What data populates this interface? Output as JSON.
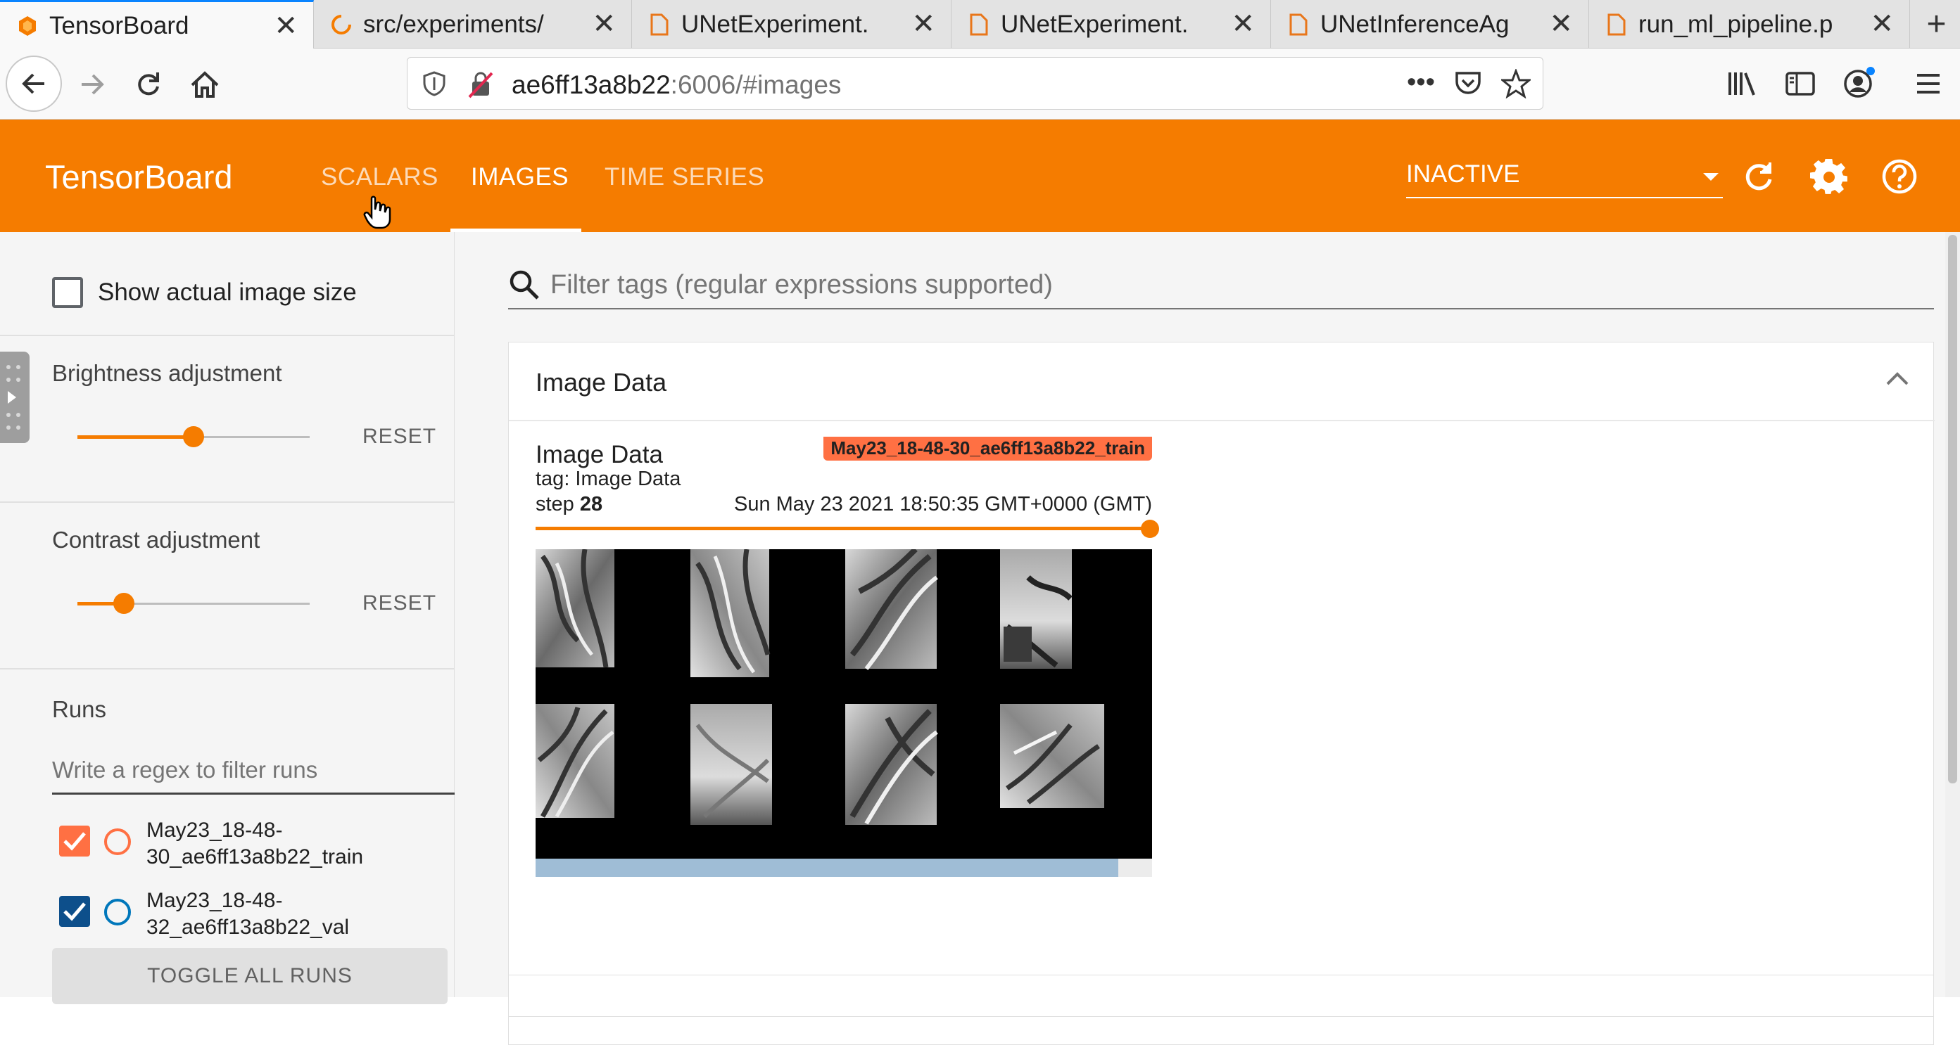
{
  "browser": {
    "tabs": [
      {
        "title": "TensorBoard",
        "icon": "tensorboard-icon",
        "active": true
      },
      {
        "title": "src/experiments/",
        "icon": "loading-icon",
        "active": false
      },
      {
        "title": "UNetExperiment.",
        "icon": "page-icon",
        "active": false
      },
      {
        "title": "UNetExperiment.",
        "icon": "page-icon",
        "active": false
      },
      {
        "title": "UNetInferenceAg",
        "icon": "page-icon",
        "active": false
      },
      {
        "title": "run_ml_pipeline.p",
        "icon": "page-icon",
        "active": false
      }
    ],
    "url_host": "ae6ff13a8b22",
    "url_rest": ":6006/#images"
  },
  "tensorboard": {
    "title": "TensorBoard",
    "nav": [
      {
        "label": "SCALARS",
        "active": false
      },
      {
        "label": "IMAGES",
        "active": true
      },
      {
        "label": "TIME SERIES",
        "active": false
      }
    ],
    "run_selector": "INACTIVE"
  },
  "sidebar": {
    "show_actual_size": "Show actual image size",
    "brightness_label": "Brightness adjustment",
    "brightness_value": 0.5,
    "contrast_label": "Contrast adjustment",
    "contrast_value": 0.2,
    "reset_label": "RESET",
    "runs_label": "Runs",
    "runs_filter_placeholder": "Write a regex to filter runs",
    "runs": [
      {
        "name": "May23_18-48-30_ae6ff13a8b22_train",
        "checked": true,
        "color": "#ff7043"
      },
      {
        "name": "May23_18-48-32_ae6ff13a8b22_val",
        "checked": true,
        "color": "#0077bb"
      }
    ],
    "toggle_all": "TOGGLE ALL RUNS"
  },
  "main": {
    "filter_placeholder": "Filter tags (regular expressions supported)",
    "section_title": "Image Data",
    "card": {
      "title": "Image Data",
      "tag": "tag: Image Data",
      "step_label": "step",
      "step": "28",
      "date": "Sun May 23 2021 18:50:35 GMT+0000 (GMT)",
      "run": "May23_18-48-30_ae6ff13a8b22_train",
      "scroll_fraction": 0.945
    }
  }
}
